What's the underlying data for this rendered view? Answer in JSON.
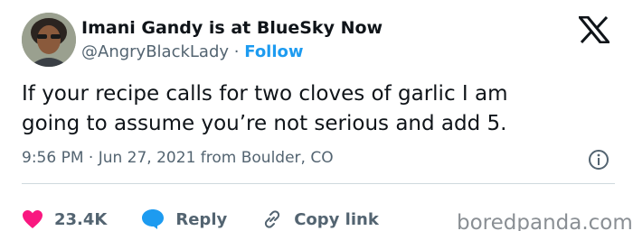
{
  "author": {
    "name": "Imani Gandy is at BlueSky Now",
    "handle": "@AngryBlackLady",
    "separator": "·",
    "follow_label": "Follow"
  },
  "tweet": {
    "text_line1": "If your recipe calls for two cloves of garlic I am",
    "text_line2": "going to assume you’re not serious and add 5.",
    "meta": "9:56 PM · Jun 27, 2021 from Boulder, CO"
  },
  "actions": {
    "like_count": "23.4K",
    "reply_label": "Reply",
    "copy_label": "Copy link"
  },
  "watermark": "boredpanda.com",
  "colors": {
    "accent": "#1d9bf0",
    "like": "#f91880",
    "text": "#0f1419",
    "secondary": "#536471"
  },
  "icons": [
    "x-logo-icon",
    "info-icon",
    "heart-icon",
    "reply-bubble-icon",
    "link-icon"
  ]
}
